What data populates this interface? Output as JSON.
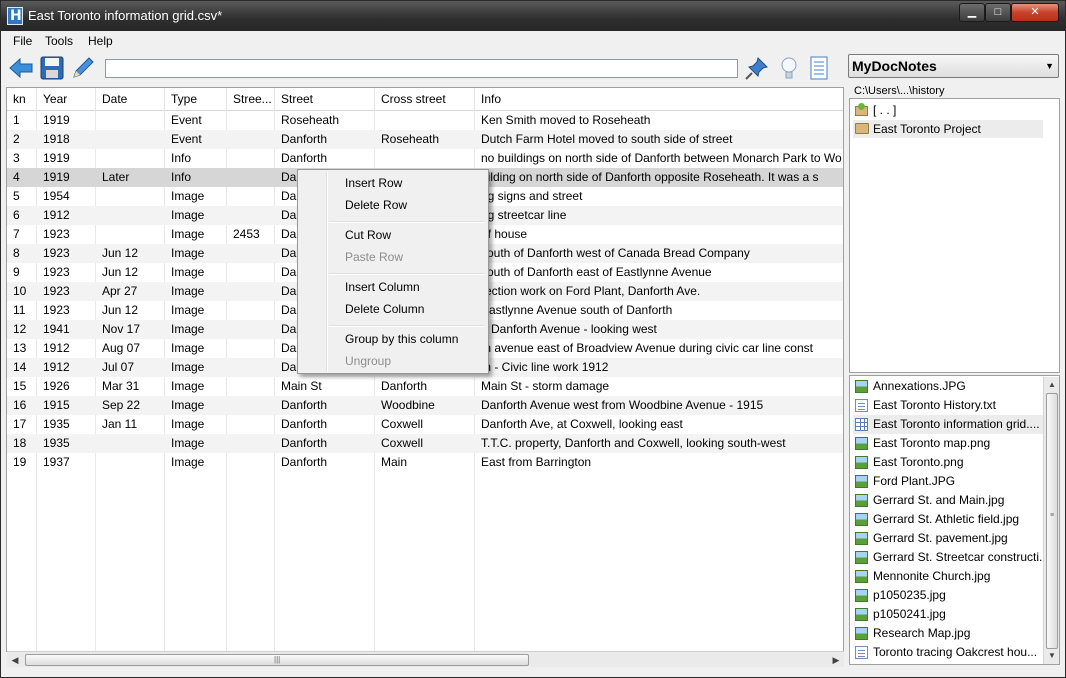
{
  "window": {
    "title": "East Toronto information grid.csv*",
    "minimize": "▁",
    "maximize": "□",
    "close": "✕"
  },
  "menu": [
    "File",
    "Tools",
    "Help"
  ],
  "toolbar": {
    "path_value": "",
    "icons": [
      "back-arrow-icon",
      "save-disk-icon",
      "edit-pencil-icon",
      "pin-icon",
      "lightbulb-icon",
      "notes-page-icon"
    ]
  },
  "grid": {
    "columns": [
      "kn",
      "Year",
      "Date",
      "Type",
      "Stree...",
      "Street",
      "Cross street",
      "Info"
    ],
    "rows": [
      [
        "1",
        "1919",
        "",
        "Event",
        "",
        "Roseheath",
        "",
        "Ken Smith moved to Roseheath"
      ],
      [
        "2",
        "1918",
        "",
        "Event",
        "",
        "Danforth",
        "Roseheath",
        "Dutch Farm Hotel moved to south side of street"
      ],
      [
        "3",
        "1919",
        "",
        "Info",
        "",
        "Danforth",
        "",
        "no buildings on north side of Danforth between Monarch Park to Wo"
      ],
      [
        "4",
        "1919",
        "Later",
        "Info",
        "",
        "Dan",
        "",
        "uilding on north side of Danforth opposite Roseheath.  It was a s"
      ],
      [
        "5",
        "1954",
        "",
        "Image",
        "",
        "Dan",
        "",
        "ng signs and street"
      ],
      [
        "6",
        "1912",
        "",
        "Image",
        "",
        "Dan",
        "",
        "ng streetcar line"
      ],
      [
        "7",
        "1923",
        "",
        "Image",
        "2453",
        "Dan",
        "",
        "of house"
      ],
      [
        "8",
        "1923",
        "Jun 12",
        "Image",
        "",
        "Dan",
        "",
        "south of Danforth west of Canada Bread Company"
      ],
      [
        "9",
        "1923",
        "Jun 12",
        "Image",
        "",
        "Dan",
        "",
        "south of Danforth east of Eastlynne Avenue"
      ],
      [
        "10",
        "1923",
        "Apr 27",
        "Image",
        "",
        "Dan",
        "",
        "rection work on Ford Plant, Danforth Ave."
      ],
      [
        "11",
        "1923",
        "Jun 12",
        "Image",
        "",
        "Dan",
        "",
        "Eastlynne Avenue south of Danforth"
      ],
      [
        "12",
        "1941",
        "Nov 17",
        "Image",
        "",
        "Dan",
        "",
        "0 Danforth Avenue - looking west"
      ],
      [
        "13",
        "1912",
        "Aug 07",
        "Image",
        "",
        "Dan",
        "",
        "th avenue east of Broadview Avenue during civic car line const"
      ],
      [
        "14",
        "1912",
        "Jul 07",
        "Image",
        "",
        "Dan",
        "",
        "th - Civic line work 1912"
      ],
      [
        "15",
        "1926",
        "Mar 31",
        "Image",
        "",
        "Main St",
        "Danforth",
        "Main St - storm damage"
      ],
      [
        "16",
        "1915",
        "Sep 22",
        "Image",
        "",
        "Danforth",
        "Woodbine",
        "Danforth Avenue west from Woodbine Avenue - 1915"
      ],
      [
        "17",
        "1935",
        "Jan 11",
        "Image",
        "",
        "Danforth",
        "Coxwell",
        "Danforth Ave, at Coxwell, looking east"
      ],
      [
        "18",
        "1935",
        "",
        "Image",
        "",
        "Danforth",
        "Coxwell",
        "T.T.C. property, Danforth and Coxwell, looking south-west"
      ],
      [
        "19",
        "1937",
        "",
        "Image",
        "",
        "Danforth",
        "Main",
        "East from Barrington"
      ]
    ],
    "selected_row": 3
  },
  "context_menu": [
    {
      "label": "Insert Row",
      "enabled": true
    },
    {
      "label": "Delete Row",
      "enabled": true
    },
    {
      "separator": true
    },
    {
      "label": "Cut Row",
      "enabled": true
    },
    {
      "label": "Paste Row",
      "enabled": false
    },
    {
      "separator": true
    },
    {
      "label": "Insert Column",
      "enabled": true
    },
    {
      "label": "Delete Column",
      "enabled": true
    },
    {
      "separator": true
    },
    {
      "label": "Group by this column",
      "enabled": true
    },
    {
      "label": "Ungroup",
      "enabled": false
    }
  ],
  "side_panel": {
    "notes_selector": "MyDocNotes",
    "path": "C:\\Users\\...\\history",
    "directories": [
      "[ . . ]",
      "East Toronto Project"
    ],
    "selected_directory": 1,
    "files": [
      {
        "name": "Annexations.JPG",
        "kind": "jpg"
      },
      {
        "name": "East Toronto History.txt",
        "kind": "txt"
      },
      {
        "name": "East Toronto information grid....",
        "kind": "csv"
      },
      {
        "name": "East Toronto map.png",
        "kind": "jpg"
      },
      {
        "name": "East Toronto.png",
        "kind": "jpg"
      },
      {
        "name": "Ford Plant.JPG",
        "kind": "jpg"
      },
      {
        "name": "Gerrard St. and Main.jpg",
        "kind": "jpg"
      },
      {
        "name": "Gerrard St. Athletic field.jpg",
        "kind": "jpg"
      },
      {
        "name": "Gerrard St. pavement.jpg",
        "kind": "jpg"
      },
      {
        "name": "Gerrard St. Streetcar constructi...",
        "kind": "jpg"
      },
      {
        "name": "Mennonite Church.jpg",
        "kind": "jpg"
      },
      {
        "name": "p1050235.jpg",
        "kind": "jpg"
      },
      {
        "name": "p1050241.jpg",
        "kind": "jpg"
      },
      {
        "name": "Research Map.jpg",
        "kind": "jpg"
      },
      {
        "name": "Toronto tracing Oakcrest hou...",
        "kind": "txt"
      }
    ],
    "selected_file": 2
  },
  "colors": {
    "accent_blue": "#2f78c4",
    "close_red": "#c8432a",
    "selected_row": "#d6d6d6"
  }
}
